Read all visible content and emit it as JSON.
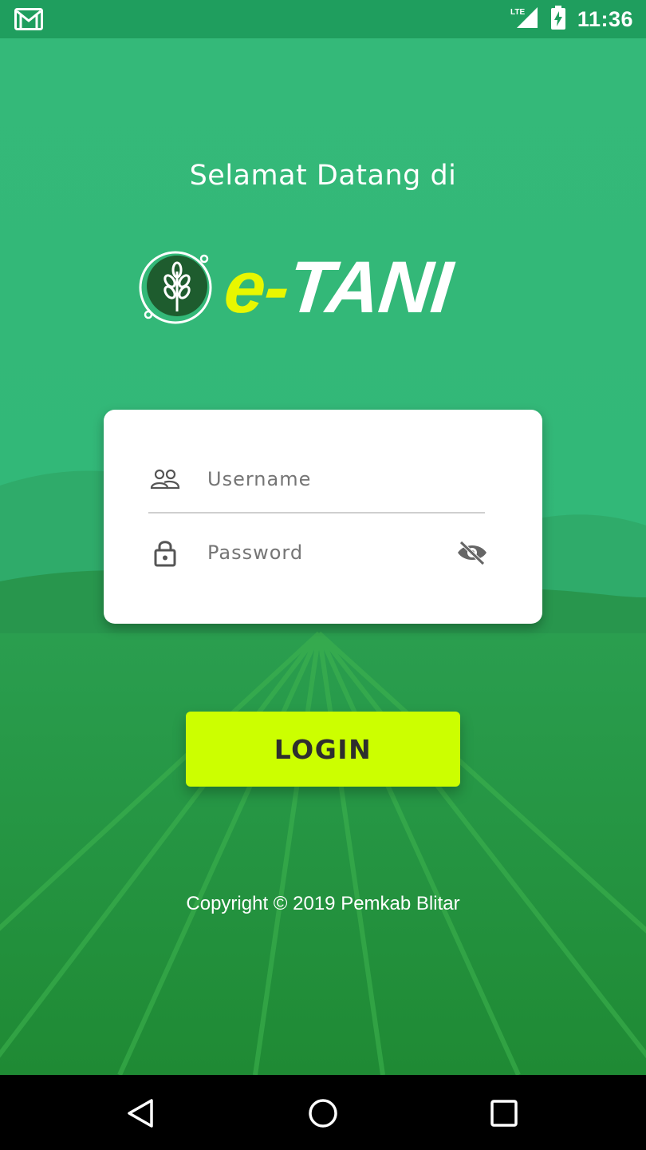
{
  "status_bar": {
    "time": "11:36",
    "network": "LTE",
    "icons": [
      "gmail-icon",
      "lte-signal-icon",
      "battery-charging-icon"
    ]
  },
  "welcome": "Selamat Datang di",
  "logo": {
    "prefix": "e-",
    "name": "TANI",
    "emblem": "wheat-icon"
  },
  "form": {
    "username_placeholder": "Username",
    "username_value": "",
    "password_placeholder": "Password",
    "password_value": "",
    "username_icon": "users-icon",
    "password_icon": "lock-icon",
    "toggle_icon": "eye-off-icon"
  },
  "login_label": "LOGIN",
  "copyright": "Copyright © 2019 Pemkab Blitar",
  "colors": {
    "primary_green": "#2fb874",
    "accent_lime": "#ccff00",
    "logo_yellow": "#e8f700",
    "status_bar": "#1f9e5e",
    "emblem_dark": "#1e5c2e"
  },
  "nav_bar": {
    "icons": [
      "back-icon",
      "home-icon",
      "recents-icon"
    ]
  }
}
